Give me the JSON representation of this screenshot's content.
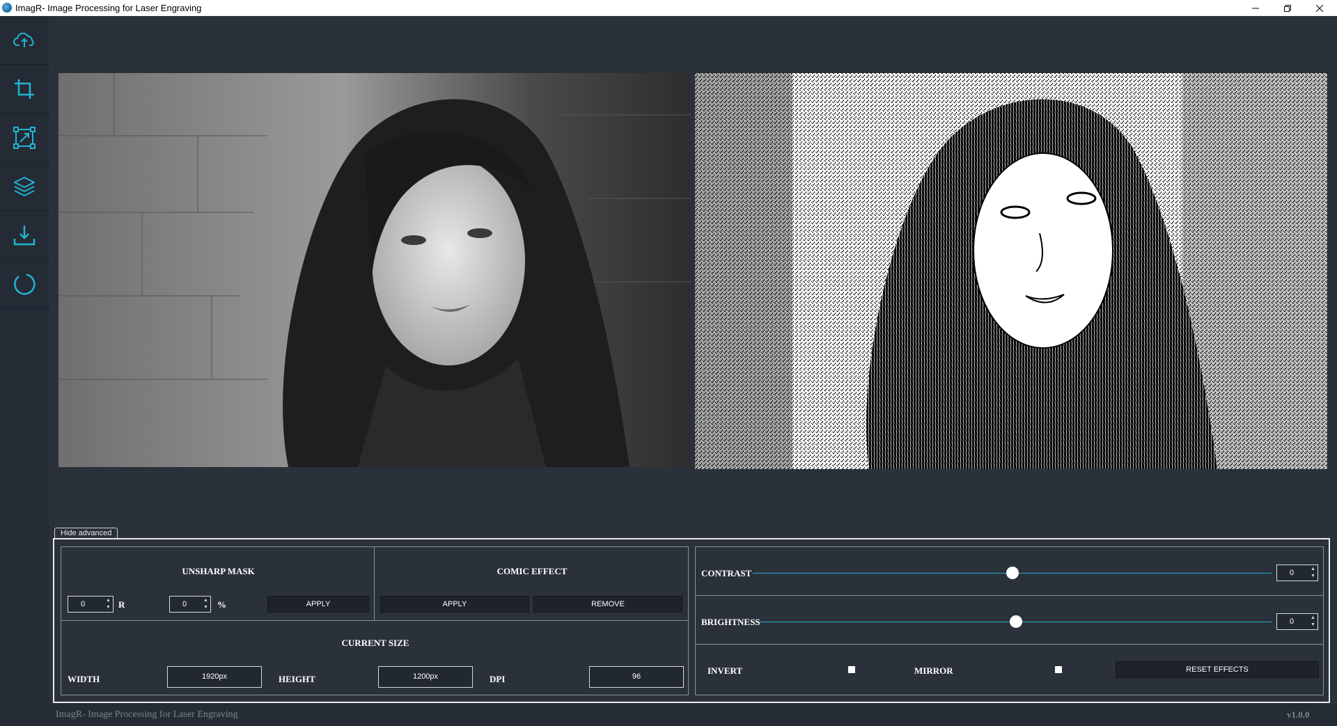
{
  "window": {
    "title": "ImagR- Image Processing for Laser Engraving",
    "controls": [
      "minimize",
      "restore",
      "close"
    ]
  },
  "sidebar": {
    "items": [
      {
        "icon": "cloud-upload-icon"
      },
      {
        "icon": "crop-icon"
      },
      {
        "icon": "resize-icon"
      },
      {
        "icon": "layers-icon"
      },
      {
        "icon": "download-icon"
      },
      {
        "icon": "reset-icon"
      }
    ],
    "icon_color": "#1fb5d3"
  },
  "advanced": {
    "toggle_label": "Hide advanced",
    "unsharp_mask": {
      "title": "UNSHARP MASK",
      "radius_value": "0",
      "radius_unit": "R",
      "percent_value": "0",
      "percent_unit": "%",
      "apply_label": "APPLY"
    },
    "comic_effect": {
      "title": "COMIC EFFECT",
      "apply_label": "APPLY",
      "remove_label": "REMOVE"
    },
    "current_size": {
      "title": "CURRENT SIZE",
      "width_label": "WIDTH",
      "width_value": "1920px",
      "height_label": "HEIGHT",
      "height_value": "1200px",
      "dpi_label": "DPI",
      "dpi_value": "96"
    },
    "adjustments": {
      "contrast_label": "CONTRAST",
      "contrast_value": "0",
      "contrast_level": 0.5,
      "brightness_label": "BRIGHTNESS",
      "brightness_value": "0",
      "brightness_level": 0.5,
      "invert_label": "INVERT",
      "mirror_label": "MIRROR",
      "reset_label": "RESET EFFECTS"
    }
  },
  "footer": {
    "title": "ImagR- Image Processing for Laser Engraving",
    "version": "v1.0.0"
  },
  "colors": {
    "background": "#2b313b",
    "sidebar": "#252b35",
    "accent": "#1fb5d3"
  }
}
